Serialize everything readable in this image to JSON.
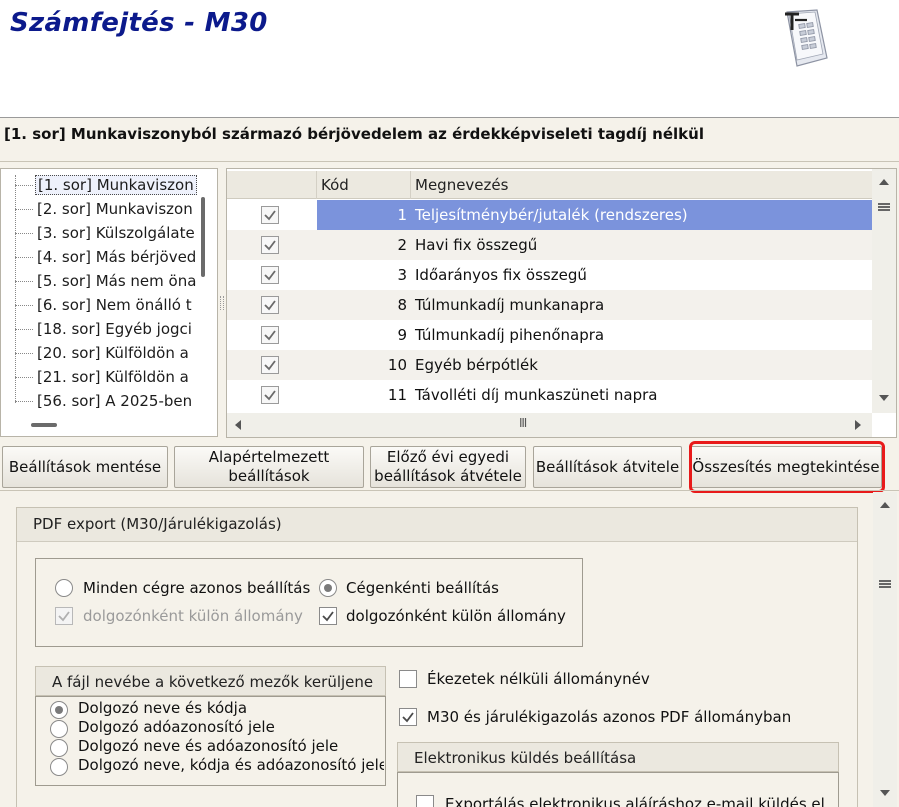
{
  "header": {
    "app_title": "Számfejtés - M30",
    "icon": "document-table-icon"
  },
  "row_title": "[1. sor] Munkaviszonyból származó bérjövedelem az érdekképviseleti tagdíj nélkül",
  "tree": {
    "items": [
      "[1. sor] Munkaviszon",
      "[2. sor] Munkaviszon",
      "[3. sor] Külszolgálate",
      "[4. sor] Más bérjöved",
      "[5. sor] Más nem öna",
      "[6. sor] Nem önálló t",
      "[18. sor] Egyéb jogci",
      "[20. sor] Külföldön a",
      "[21. sor] Külföldön a",
      "[56. sor] A 2025-ben"
    ],
    "selected_index": 0
  },
  "grid": {
    "col_code": "Kód",
    "col_name": "Megnevezés",
    "rows": [
      {
        "checked": true,
        "code": "1",
        "name": "Teljesítménybér/jutalék (rendszeres)"
      },
      {
        "checked": true,
        "code": "2",
        "name": "Havi fix összegű"
      },
      {
        "checked": true,
        "code": "3",
        "name": "Időarányos fix összegű"
      },
      {
        "checked": true,
        "code": "8",
        "name": "Túlmunkadíj munkanapra"
      },
      {
        "checked": true,
        "code": "9",
        "name": "Túlmunkadíj pihenőnapra"
      },
      {
        "checked": true,
        "code": "10",
        "name": "Egyéb bérpótlék"
      },
      {
        "checked": true,
        "code": "11",
        "name": "Távolléti díj munkaszüneti napra"
      }
    ],
    "selected_row": 0,
    "hscroll_grip": "Ⅲ"
  },
  "buttons": {
    "save": "Beállítások mentése",
    "default_l1": "Alapértelmezett",
    "default_l2": "beállítások",
    "prev_l1": "Előző évi egyedi",
    "prev_l2": "beállítások átvétele",
    "transfer": "Beállítások átvitele",
    "summary": "Összesítés megtekintése"
  },
  "pdf_panel": {
    "title": "PDF export (M30/Járulékigazolás)",
    "mode_same": "Minden cégre azonos beállítás",
    "mode_per_company": "Cégenkénti beállítás",
    "mode_selected": "per_company",
    "per_employee_left": "dolgozónként külön állomány",
    "per_employee_right": "dolgozónként külön állomány",
    "per_employee_left_checked": true,
    "per_employee_right_checked": true,
    "filename_group_title": "A fájl nevébe a következő mezők kerüljene",
    "filename_options": [
      "Dolgozó neve és kódja",
      "Dolgozó adóazonosító jele",
      "Dolgozó neve és adóazonosító jele",
      "Dolgozó neve, kódja és adóazonosító jele"
    ],
    "filename_selected": 0,
    "no_accents": "Ékezetek nélküli állománynév",
    "no_accents_checked": false,
    "same_pdf": "M30 és járulékigazolás azonos PDF állományban",
    "same_pdf_checked": true,
    "electronic_title": "Elektronikus küldés beállítása",
    "electronic_option": "Exportálás elektronikus aláíráshoz e-mail küldés elő"
  },
  "colors": {
    "title_blue": "#0c1a8c",
    "selection": "#7b93dc",
    "highlight_red": "#e81a1a"
  }
}
